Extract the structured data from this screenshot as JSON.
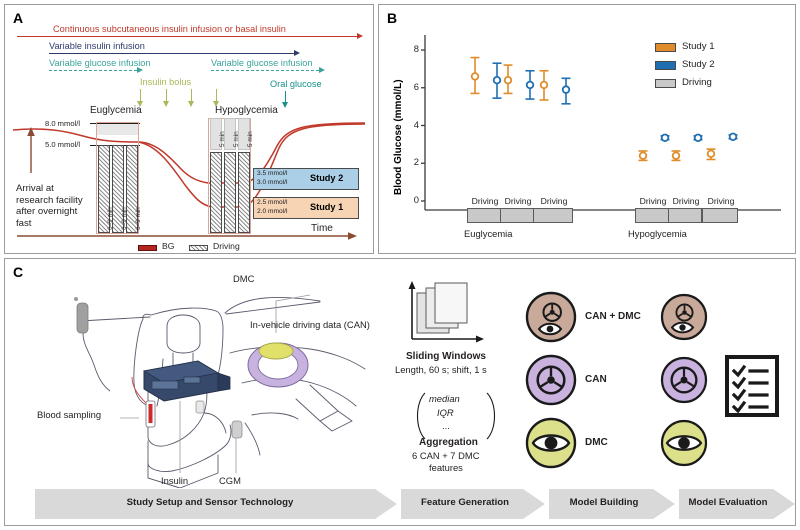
{
  "panels": {
    "a": {
      "letter": "A",
      "infusions": {
        "continuous": "Continuous subcutaneous insulin infusion or basal insulin",
        "variable_insulin": "Variable insulin infusion",
        "variable_glucose_1": "Variable glucose infusion",
        "variable_glucose_2": "Variable glucose infusion",
        "insulin_bolus": "Insulin bolus",
        "oral_glucose": "Oral glucose"
      },
      "phase_labels": {
        "eu": "Euglycemia",
        "hypo": "Hypoglycemia"
      },
      "y_ticks": [
        "8.0 mmol/l",
        "5.0 mmol/l"
      ],
      "arrival_text": "Arrival at research facility after overnight fast",
      "time_label": "Time",
      "eu_drive_labels": [
        "6–9 min",
        "6–9 min",
        "6–9 min"
      ],
      "hypo_rest_labels": [
        "5 min",
        "5 min",
        "5 min"
      ],
      "study2": {
        "name": "Study 2",
        "upper": "3.5 mmol/l",
        "lower": "3.0 mmol/l"
      },
      "study1": {
        "name": "Study 1",
        "upper": "2.5 mmol/l",
        "lower": "2.0 mmol/l"
      },
      "legend": [
        "BG",
        "Driving"
      ],
      "colors": {
        "bg_red": "#c0392b",
        "navy": "#2f3b6b",
        "teal": "#3aa39b",
        "olive": "#a8b95a",
        "study2": "#aacfe6",
        "study1": "#f6d4b4"
      }
    },
    "b": {
      "letter": "B"
    },
    "c": {
      "letter": "C",
      "diagram_labels": {
        "dmc": "DMC",
        "can": "In-vehicle driving data (CAN)",
        "blood": "Blood sampling",
        "insulin": "Insulin",
        "cgm": "CGM"
      },
      "feature_generation": {
        "sliding_title": "Sliding Windows",
        "sliding_sub": "Length, 60 s; shift, 1 s",
        "agg_items": [
          "median",
          "IQR",
          "..."
        ],
        "agg_title": "Aggregation",
        "agg_sub_1": "6 CAN + 7 DMC",
        "agg_sub_2": "features"
      },
      "models": [
        {
          "label": "CAN + DMC",
          "color": "#c9a99a",
          "icons": [
            "steering-wheel",
            "eye"
          ]
        },
        {
          "label": "CAN",
          "color": "#c9b3de",
          "icons": [
            "steering-wheel"
          ]
        },
        {
          "label": "DMC",
          "color": "#dde08a",
          "icons": [
            "eye"
          ]
        }
      ],
      "ribbon": [
        "Study Setup and Sensor Technology",
        "Feature Generation",
        "Model Building",
        "Model Evaluation"
      ]
    }
  },
  "chart_data": {
    "type": "scatter",
    "title": "",
    "xlabel": "",
    "ylabel": "Blood Glucose (mmol/L)",
    "ylim": [
      0,
      8.8
    ],
    "yticks": [
      0,
      2,
      4,
      6,
      8
    ],
    "ytick_labels": [
      "0",
      "2",
      "4",
      "6",
      "8"
    ],
    "grid": false,
    "legend_position": "top-right",
    "legend": [
      {
        "name": "Study 1",
        "color": "#e08c2a"
      },
      {
        "name": "Study 2",
        "color": "#1f6fb2"
      },
      {
        "name": "Driving",
        "color": "#c9c9c9"
      }
    ],
    "group_labels": [
      "Euglycemia",
      "Hypoglycemia"
    ],
    "driving_labels": [
      "Driving",
      "Driving",
      "Driving",
      "Driving",
      "Driving",
      "Driving"
    ],
    "series": [
      {
        "name": "Study 1",
        "color": "#e08c2a",
        "points": [
          {
            "group": "Euglycemia",
            "bout": 1,
            "mean": 6.6,
            "low": 5.7,
            "high": 7.6
          },
          {
            "group": "Euglycemia",
            "bout": 2,
            "mean": 6.4,
            "low": 5.7,
            "high": 7.2
          },
          {
            "group": "Euglycemia",
            "bout": 3,
            "mean": 6.15,
            "low": 5.35,
            "high": 6.9
          },
          {
            "group": "Hypoglycemia",
            "bout": 1,
            "mean": 2.4,
            "low": 2.15,
            "high": 2.65
          },
          {
            "group": "Hypoglycemia",
            "bout": 2,
            "mean": 2.4,
            "low": 2.15,
            "high": 2.65
          },
          {
            "group": "Hypoglycemia",
            "bout": 3,
            "mean": 2.5,
            "low": 2.2,
            "high": 2.75
          }
        ]
      },
      {
        "name": "Study 2",
        "color": "#1f6fb2",
        "points": [
          {
            "group": "Euglycemia",
            "bout": 1,
            "mean": 6.4,
            "low": 5.45,
            "high": 7.3
          },
          {
            "group": "Euglycemia",
            "bout": 2,
            "mean": 6.15,
            "low": 5.4,
            "high": 6.9
          },
          {
            "group": "Euglycemia",
            "bout": 3,
            "mean": 5.9,
            "low": 5.15,
            "high": 6.5
          },
          {
            "group": "Hypoglycemia",
            "bout": 1,
            "mean": 3.35,
            "low": 3.25,
            "high": 3.45
          },
          {
            "group": "Hypoglycemia",
            "bout": 2,
            "mean": 3.35,
            "low": 3.25,
            "high": 3.45
          },
          {
            "group": "Hypoglycemia",
            "bout": 3,
            "mean": 3.4,
            "low": 3.3,
            "high": 3.5
          }
        ]
      }
    ]
  }
}
